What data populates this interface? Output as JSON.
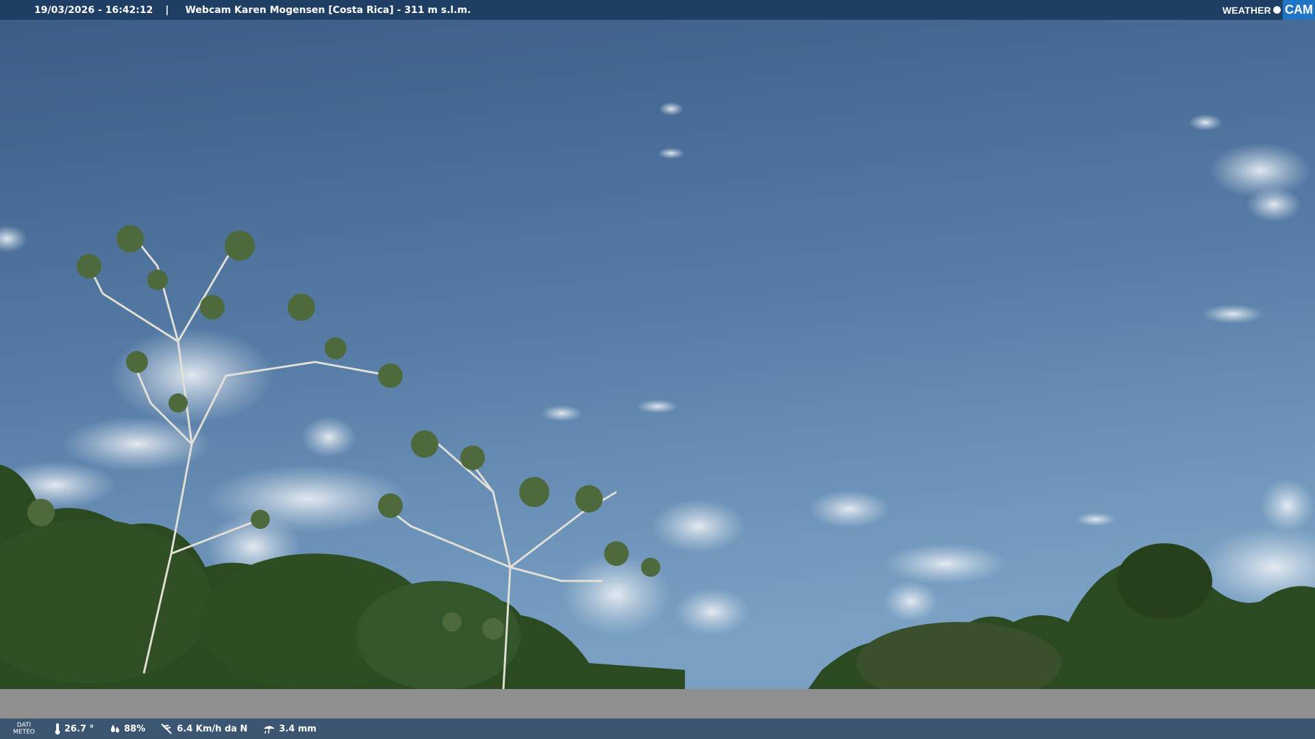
{
  "header": {
    "timestamp": "19/03/2026 - 16:42:12",
    "separator": "|",
    "title": "Webcam Karen Mogensen [Costa Rica]  - 311 m s.l.m."
  },
  "logo": {
    "text_weather": "WEATHER",
    "text_cam": "CAM",
    "accent_color": "#1f76c7"
  },
  "footer": {
    "label_line1": "DATI",
    "label_line2": "METEO",
    "temperature": "26.7 °",
    "humidity": "88%",
    "wind": "6.4 Km/h da N",
    "rain": "3.4 mm",
    "icons": [
      "thermometer-icon",
      "humidity-icon",
      "wind-icon",
      "rain-icon"
    ]
  },
  "colors": {
    "header_bg": "#1f3e64",
    "footer_bg": "#3c5671",
    "sky_top": "#3d5f88",
    "sky_bottom": "#6f96bd",
    "foliage": "#2b4a1f"
  }
}
